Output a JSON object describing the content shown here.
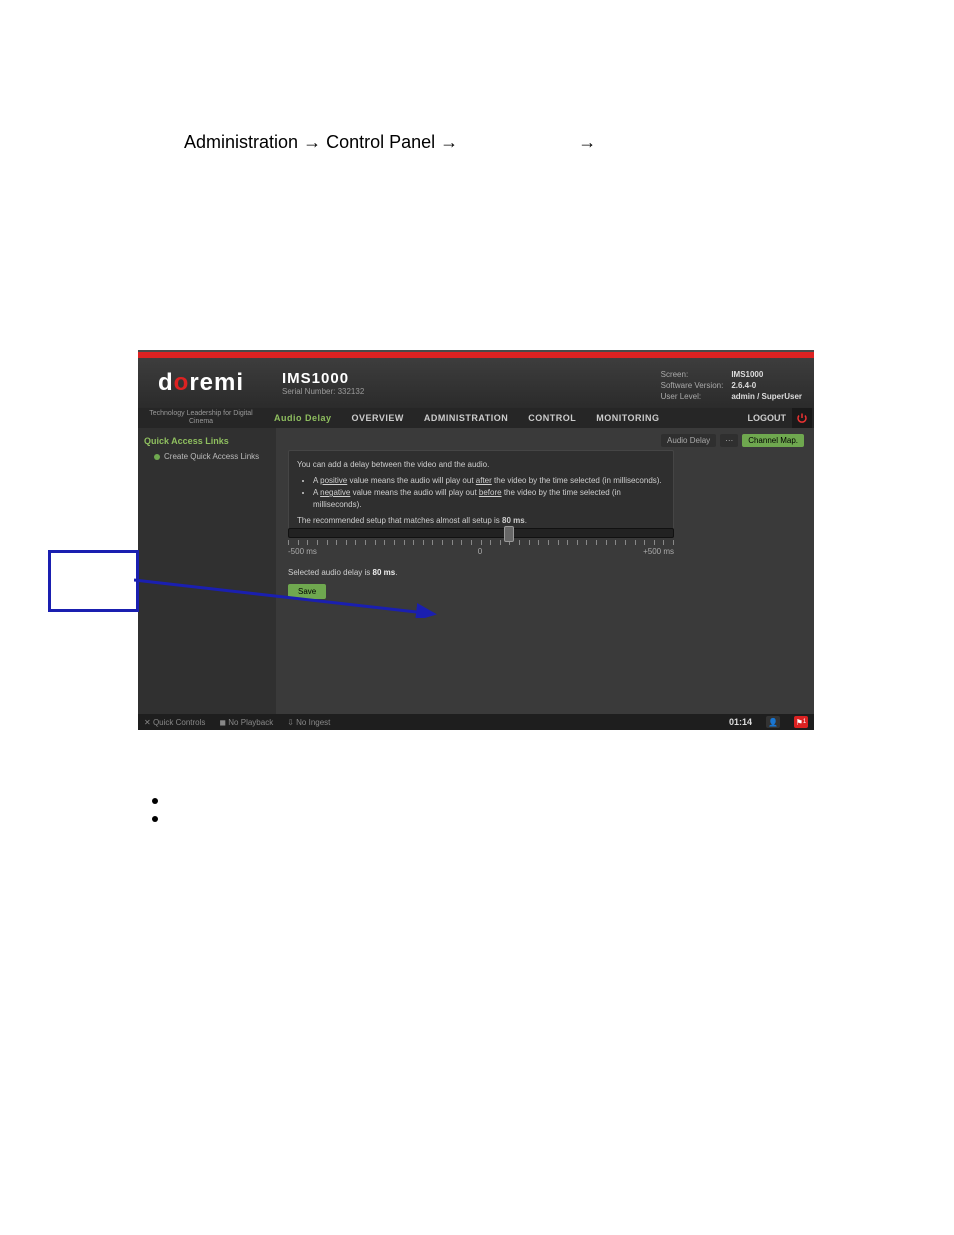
{
  "breadcrumb": {
    "part1": "Administration",
    "arrow": "→",
    "part2": "Control Panel",
    "gap_arrow": "→"
  },
  "screenshot": {
    "logo": {
      "pre": "d",
      "highlight": "o",
      "post": "remi"
    },
    "product_title": "IMS1000",
    "serial_number_label": "Serial Number: 332132",
    "sysinfo": {
      "screen_k": "Screen:",
      "screen_v": "IMS1000",
      "sw_k": "Software Version:",
      "sw_v": "2.6.4-0",
      "ul_k": "User Level:",
      "ul_v": "admin / SuperUser"
    },
    "tagline": "Technology Leadership for Digital Cinema",
    "nav": {
      "active": "Audio Delay",
      "overview": "OVERVIEW",
      "administration": "ADMINISTRATION",
      "control": "CONTROL",
      "monitoring": "MONITORING",
      "logout": "LOGOUT"
    },
    "sidebar": {
      "title": "Quick Access Links",
      "create": "Create Quick Access Links"
    },
    "subnav": {
      "audio_delay": "Audio Delay",
      "channel_map": "Channel Map."
    },
    "info": {
      "line1": "You can add a delay between the video and the audio.",
      "bullet1_a": "A ",
      "bullet1_u": "positive",
      "bullet1_b": " value means the audio will play out ",
      "bullet1_u2": "after",
      "bullet1_c": " the video by the time selected (in milliseconds).",
      "bullet2_a": "A ",
      "bullet2_u": "negative",
      "bullet2_b": " value means the audio will play out ",
      "bullet2_u2": "before",
      "bullet2_c": " the video by the time selected (in milliseconds).",
      "line_rec_a": "The recommended setup that matches almost all setup is ",
      "line_rec_b": "80 ms",
      "line_rec_c": "."
    },
    "slider": {
      "min_label": "-500 ms",
      "zero_label": "0",
      "max_label": "+500 ms"
    },
    "selected_text_a": "Selected audio delay is ",
    "selected_text_b": "80 ms",
    "selected_text_c": ".",
    "save_label": "Save",
    "footer": {
      "quick": "Quick Controls",
      "playback": "No Playback",
      "ingest": "No Ingest",
      "clock": "01:14",
      "badge": "1"
    }
  }
}
